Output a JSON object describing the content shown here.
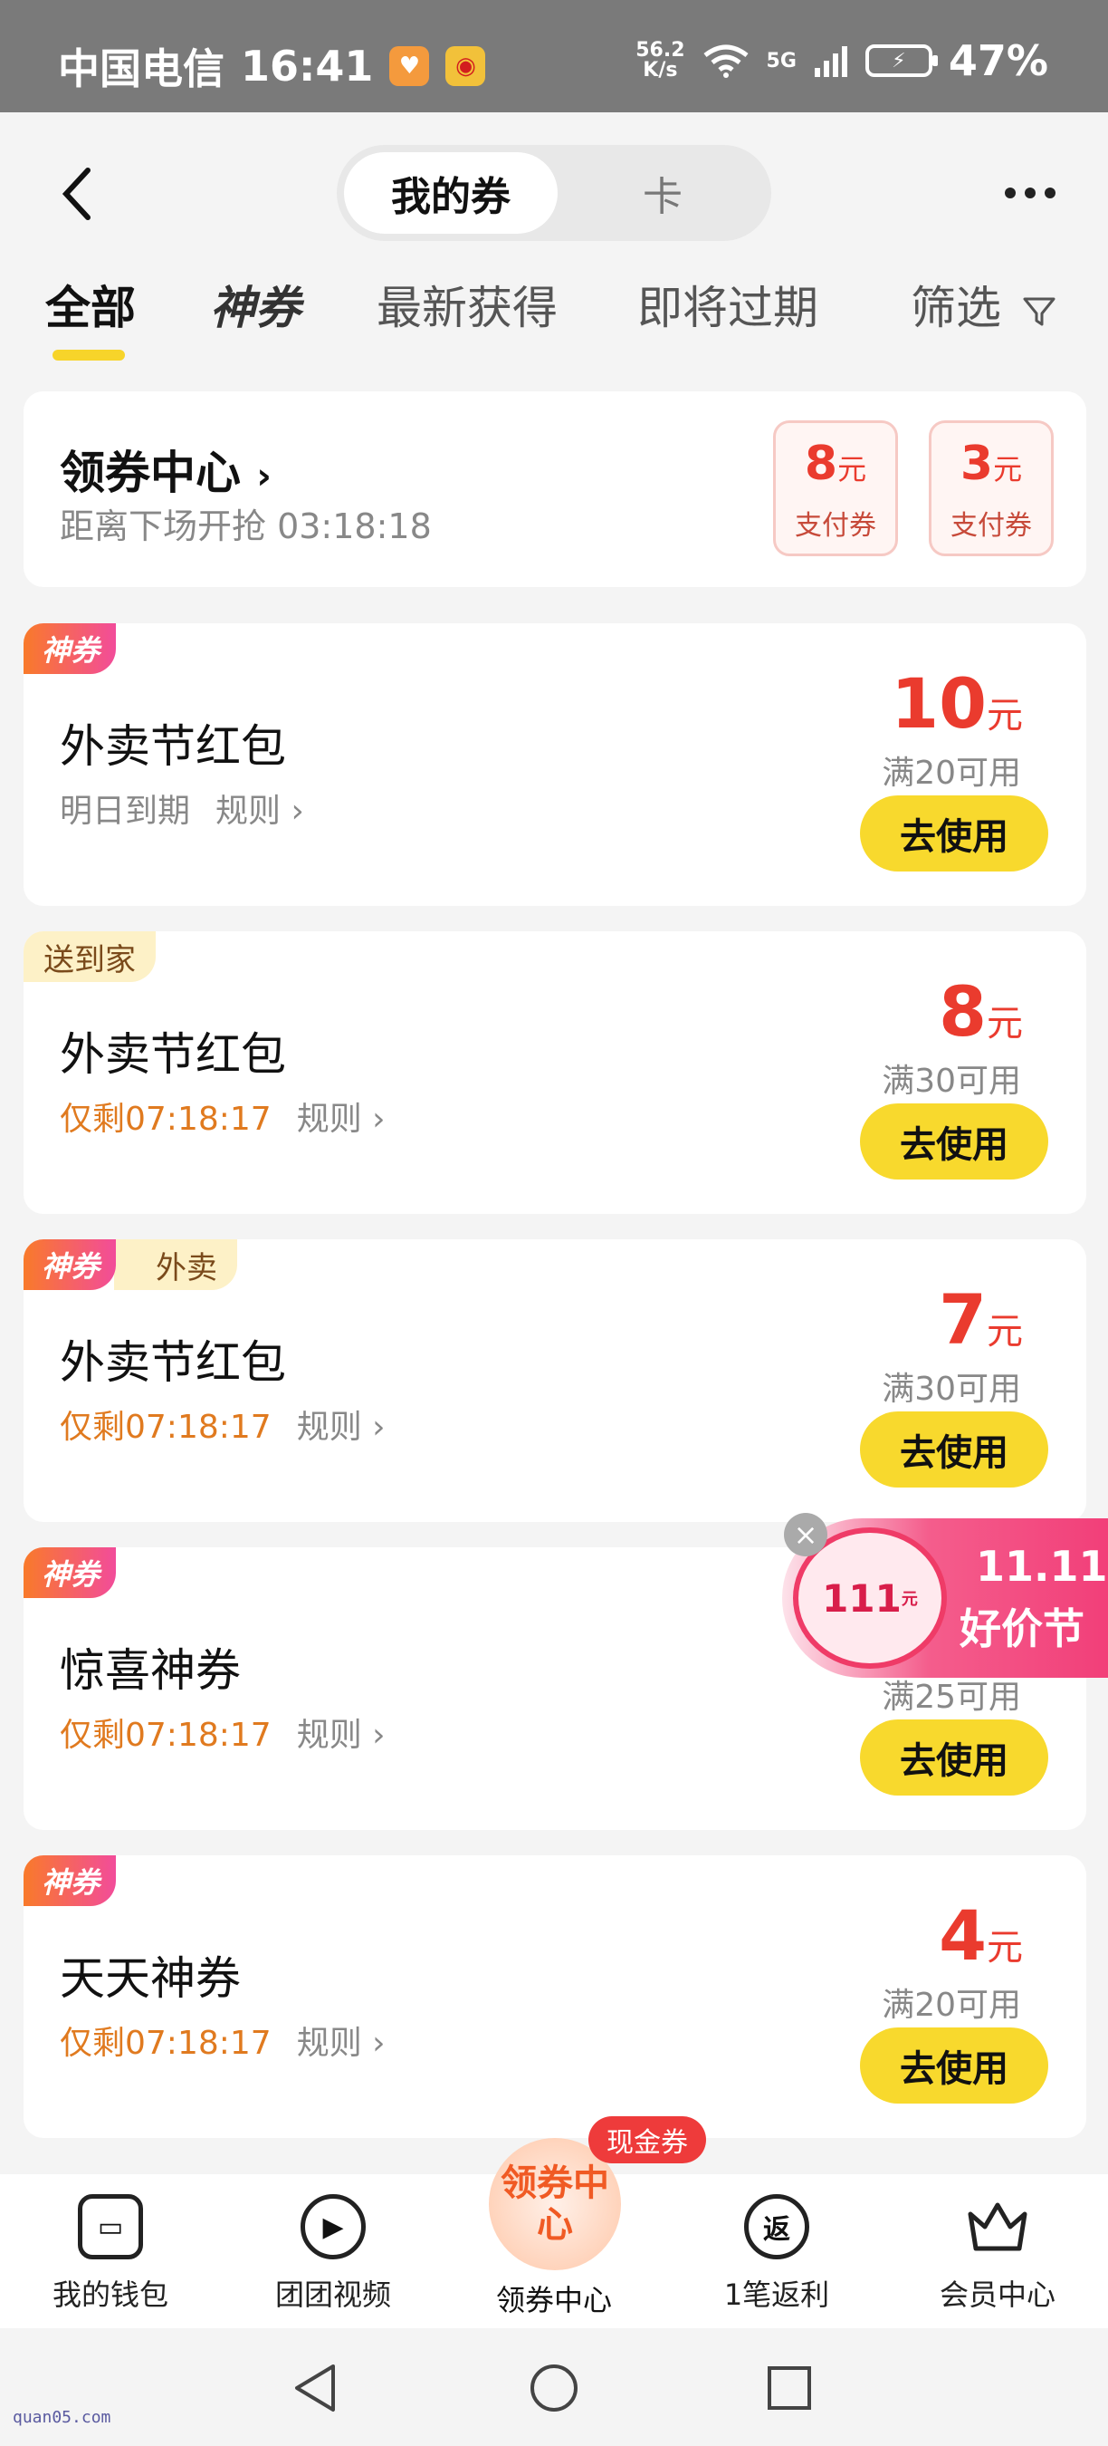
{
  "status_bar": {
    "carrier": "中国电信",
    "time": "16:41",
    "speed_value": "56.2",
    "speed_unit": "K/s",
    "network": "5G",
    "battery": "47%"
  },
  "header": {
    "segments": [
      "我的券",
      "卡"
    ],
    "filter_tabs": [
      "全部",
      "神券",
      "最新获得",
      "即将过期",
      "筛选"
    ]
  },
  "coupon_center": {
    "title": "领券中心",
    "countdown": "距离下场开抢 03:18:18",
    "mini_coupons": [
      {
        "value": "8",
        "unit": "元",
        "label": "支付券"
      },
      {
        "value": "3",
        "unit": "元",
        "label": "支付券"
      }
    ]
  },
  "coupons": [
    {
      "tag": "神券",
      "title": "外卖节红包",
      "expiry": "明日到期",
      "rule": "规则",
      "amount": "10",
      "unit": "元",
      "condition": "满20可用",
      "action": "去使用"
    },
    {
      "tag2": "送到家",
      "title": "外卖节红包",
      "expiry": "仅剩07:18:17",
      "rule": "规则",
      "amount": "8",
      "unit": "元",
      "condition": "满30可用",
      "action": "去使用"
    },
    {
      "tag": "神券",
      "tag2": "外卖",
      "title": "外卖节红包",
      "expiry": "仅剩07:18:17",
      "rule": "规则",
      "amount": "7",
      "unit": "元",
      "condition": "满30可用",
      "action": "去使用"
    },
    {
      "tag": "神券",
      "title": "惊喜神券",
      "expiry": "仅剩07:18:17",
      "rule": "规则",
      "amount": "",
      "unit": "",
      "condition": "满25可用",
      "action": "去使用"
    },
    {
      "tag": "神券",
      "title": "天天神券",
      "expiry": "仅剩07:18:17",
      "rule": "规则",
      "amount": "4",
      "unit": "元",
      "condition": "满20可用",
      "action": "去使用"
    }
  ],
  "promo_float": {
    "coin_text": "111",
    "coin_unit": "元",
    "line1": "11.11",
    "line2": "好价节"
  },
  "bottom_nav": {
    "items": [
      "我的钱包",
      "团团视频",
      "领券中心",
      "1笔返利",
      "会员中心"
    ],
    "center_icon_text": "领券中心",
    "cash_tag": "现金券",
    "rebate_icon": "返"
  },
  "watermark": "quan05.com"
}
